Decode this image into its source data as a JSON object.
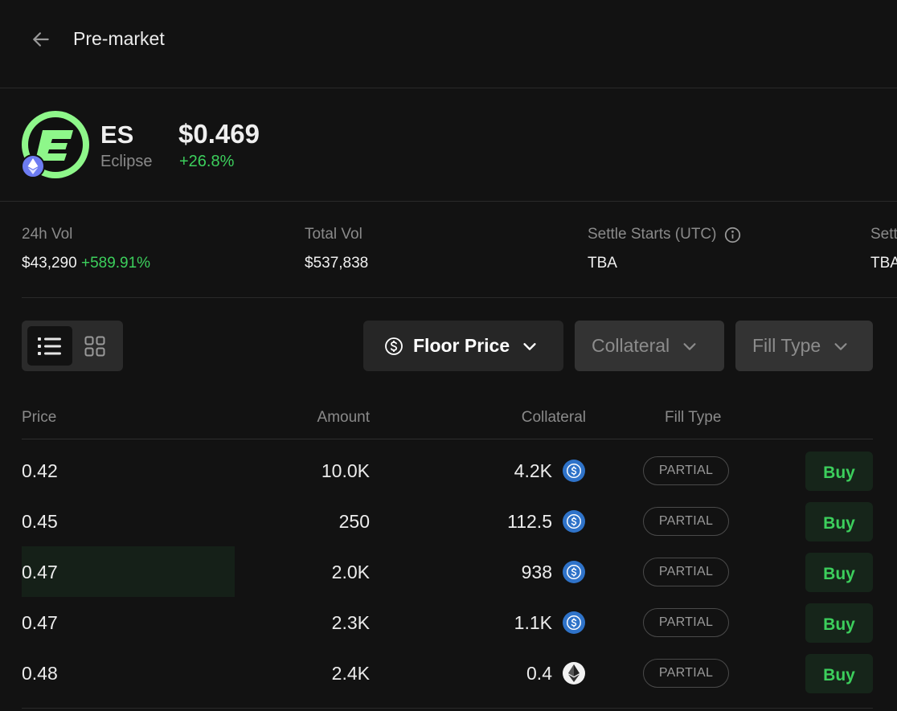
{
  "header": {
    "title": "Pre-market"
  },
  "token": {
    "ticker": "ES",
    "name": "Eclipse",
    "price": "$0.469",
    "change": "+26.8%",
    "logo_color": "#8ef78a",
    "chain": "ethereum"
  },
  "stats": [
    {
      "label": "24h Vol",
      "value": "$43,290",
      "change": "+589.91%"
    },
    {
      "label": "Total Vol",
      "value": "$537,838"
    },
    {
      "label": "Settle Starts (UTC)",
      "value": "TBA",
      "info_icon": "info-icon"
    },
    {
      "label": "Settle Ends (UTC)",
      "value": "TBA"
    }
  ],
  "toolbar": {
    "view_modes": [
      "list",
      "grid"
    ],
    "active_view": "list",
    "filters": {
      "floor_price": "Floor Price",
      "collateral": "Collateral",
      "fill_type": "Fill Type"
    }
  },
  "table": {
    "columns": {
      "price": "Price",
      "amount": "Amount",
      "collateral": "Collateral",
      "fill_type": "Fill Type"
    },
    "rows": [
      {
        "price": "0.42",
        "amount": "10.0K",
        "collateral": "4.2K",
        "token": "usdc",
        "fill": "PARTIAL",
        "action": "Buy"
      },
      {
        "price": "0.45",
        "amount": "250",
        "collateral": "112.5",
        "token": "usdc",
        "fill": "PARTIAL",
        "action": "Buy"
      },
      {
        "price": "0.47",
        "amount": "2.0K",
        "collateral": "938",
        "token": "usdc",
        "fill": "PARTIAL",
        "action": "Buy",
        "highlight": 0.25
      },
      {
        "price": "0.47",
        "amount": "2.3K",
        "collateral": "1.1K",
        "token": "usdc",
        "fill": "PARTIAL",
        "action": "Buy"
      },
      {
        "price": "0.48",
        "amount": "2.4K",
        "collateral": "0.4",
        "token": "eth",
        "fill": "PARTIAL",
        "action": "Buy"
      }
    ]
  },
  "colors": {
    "background": "#121212",
    "positive": "#3ccf5c",
    "usdc": "#2f73c9",
    "eth": "#f2f2f2"
  }
}
